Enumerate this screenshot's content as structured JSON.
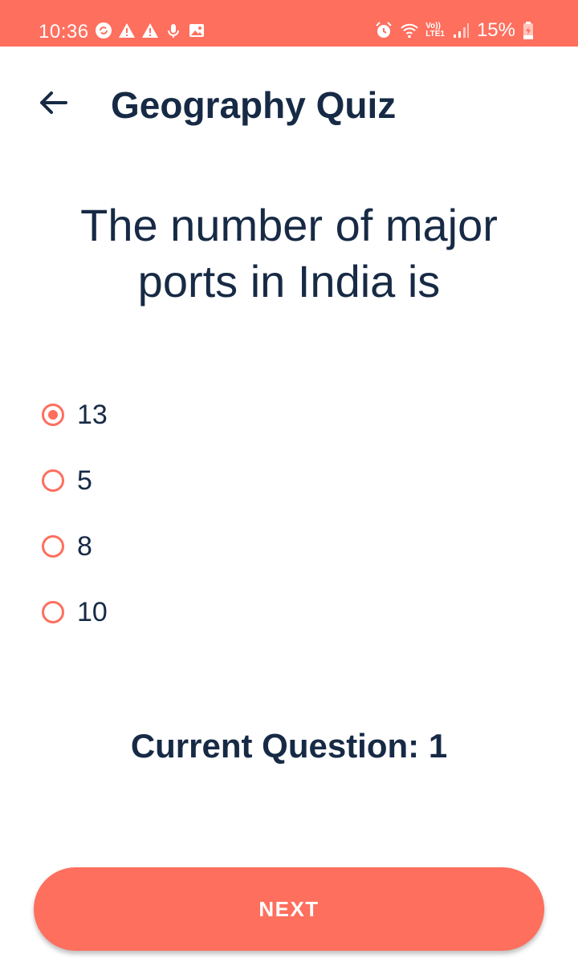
{
  "status_bar": {
    "time": "10:36",
    "left_icons": [
      "sync-icon",
      "warning-icon",
      "warning-icon",
      "mic-icon",
      "image-icon"
    ],
    "right_icons": [
      "alarm-icon",
      "wifi-icon",
      "signal-icon",
      "battery-icon"
    ],
    "volte_top": "Vo))",
    "volte_bottom": "LTE1",
    "battery": "15%"
  },
  "app_bar": {
    "title": "Geography Quiz",
    "back_icon": "arrow-left-icon"
  },
  "quiz": {
    "question": "The number of major ports in India is",
    "options": [
      {
        "label": "13",
        "selected": true
      },
      {
        "label": "5",
        "selected": false
      },
      {
        "label": "8",
        "selected": false
      },
      {
        "label": "10",
        "selected": false
      }
    ],
    "current_question_label": "Current Question: 1"
  },
  "footer": {
    "next_label": "NEXT"
  },
  "colors": {
    "accent": "#fe6f5e",
    "text": "#172a45",
    "background": "#ffffff"
  }
}
